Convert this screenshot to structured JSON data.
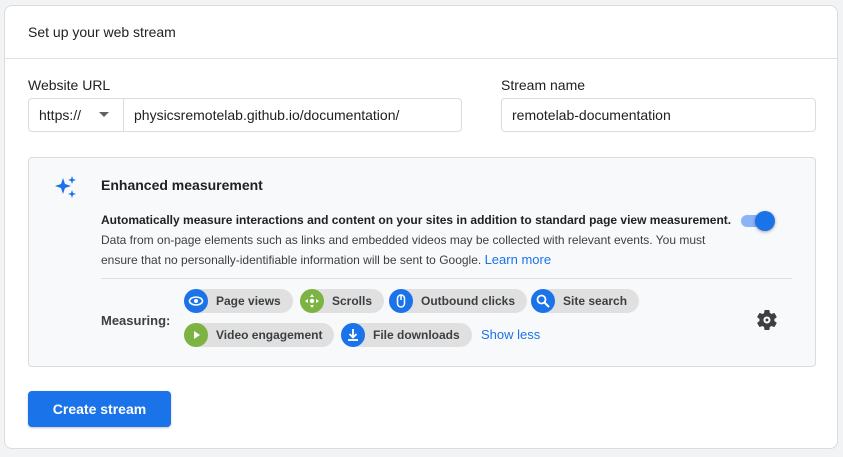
{
  "header": {
    "title": "Set up your web stream"
  },
  "website_url": {
    "label": "Website URL",
    "protocol": "https://",
    "value": "physicsremotelab.github.io/documentation/"
  },
  "stream_name": {
    "label": "Stream name",
    "value": "remotelab-documentation"
  },
  "enhanced_measurement": {
    "title": "Enhanced measurement",
    "desc_bold": "Automatically measure interactions and content on your sites in addition to standard page view measurement.",
    "desc_normal": "Data from on-page elements such as links and embedded videos may be collected with relevant events. You must ensure that no personally-identifiable information will be sent to Google.",
    "learn_more": "Learn more",
    "enabled": true,
    "measuring_label": "Measuring:",
    "chips": [
      {
        "label": "Page views",
        "icon": "eye-icon",
        "color": "#1a73e8"
      },
      {
        "label": "Scrolls",
        "icon": "crosshair-icon",
        "color": "#7cb342"
      },
      {
        "label": "Outbound clicks",
        "icon": "mouse-icon",
        "color": "#1a73e8"
      },
      {
        "label": "Site search",
        "icon": "search-icon",
        "color": "#1a73e8"
      },
      {
        "label": "Video engagement",
        "icon": "play-icon",
        "color": "#7cb342"
      },
      {
        "label": "File downloads",
        "icon": "download-icon",
        "color": "#1a73e8"
      }
    ],
    "show_less": "Show less"
  },
  "create_button": {
    "label": "Create stream"
  },
  "colors": {
    "accent": "#1a73e8",
    "accent_light": "#8ab4f8",
    "green": "#7cb342"
  }
}
